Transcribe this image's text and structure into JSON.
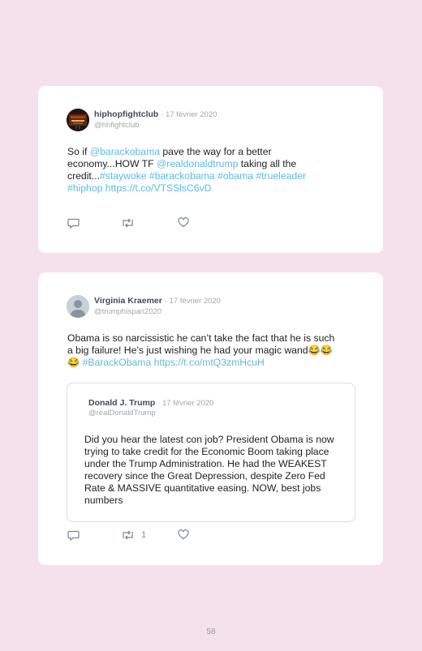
{
  "tweets": [
    {
      "name": "hiphopfightclub",
      "date": "· 17 février 2020",
      "handle": "@hhfightclub",
      "body": [
        {
          "t": "So if ",
          "link": false
        },
        {
          "t": "@barackobama",
          "link": true
        },
        {
          "t": " pave the way for a better economy...HOW TF ",
          "link": false
        },
        {
          "t": "@realdonaldtrump",
          "link": true
        },
        {
          "t": " taking all the credit...",
          "link": false
        },
        {
          "t": "#staywoke #barackobama #obama #trueleader #hiphop https://t.co/VTSSlsC6vD",
          "link": true
        }
      ],
      "retweet_count": ""
    },
    {
      "name": "Virginia Kraemer",
      "date": "· 17 février 2020",
      "handle": "@trumphispan2020",
      "body": [
        {
          "t": "Obama is so narcissistic he can’t take the fact that he is such a big failure! He’s just wishing he had your magic wand😂😂😂 ",
          "link": false
        },
        {
          "t": "#BarackObama https://t.co/mtQ3zmHcuH",
          "link": true
        }
      ],
      "retweet_count": "1",
      "quoted": {
        "name": "Donald J. Trump",
        "date": "· 17 février 2020",
        "handle": "@realDonaldTrump",
        "body": "Did you hear the latest con job? President Obama is now trying to take credit for the Economic Boom taking place under the Trump Administration. He had the WEAKEST recovery since the Great Depression, despite Zero Fed Rate & MASSIVE quantitative easing. NOW, best jobs numbers"
      }
    }
  ],
  "page_number": "58",
  "colors": {
    "background": "#f5e1ec",
    "card": "#ffffff",
    "link": "#5fb9e3",
    "icon": "#7a8694"
  },
  "icons": [
    "reply-icon",
    "retweet-icon",
    "like-icon"
  ]
}
